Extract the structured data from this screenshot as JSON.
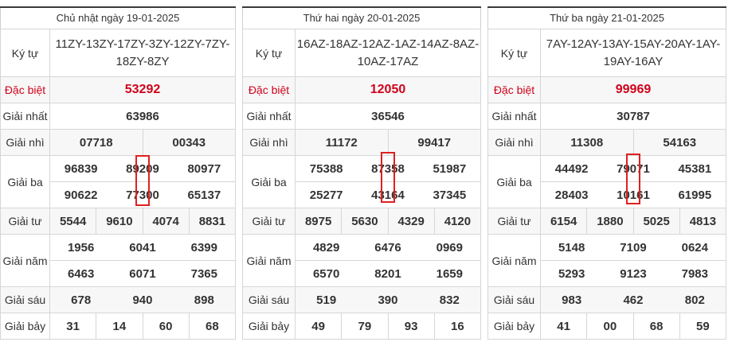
{
  "days": [
    {
      "date": "Chủ nhật ngày 19-01-2025",
      "labels": {
        "code": "Ký tự",
        "special": "Đặc biệt",
        "first": "Giải nhất",
        "second": "Giải nhì",
        "third": "Giải ba",
        "fourth": "Giải tư",
        "fifth": "Giải năm",
        "sixth": "Giải sáu",
        "seventh": "Giải bảy"
      },
      "code": "11ZY-13ZY-17ZY-3ZY-12ZY-7ZY-18ZY-8ZY",
      "special": "53292",
      "first": "63986",
      "second": [
        "07718",
        "00343"
      ],
      "third": [
        "96839",
        "89209",
        "80977",
        "90622",
        "77300",
        "65137"
      ],
      "fourth": [
        "5544",
        "9610",
        "4074",
        "8831"
      ],
      "fifth": [
        "1956",
        "6041",
        "6399",
        "6463",
        "6071",
        "7365"
      ],
      "sixth": [
        "678",
        "940",
        "898"
      ],
      "seventh": [
        "31",
        "14",
        "60",
        "68"
      ]
    },
    {
      "date": "Thứ hai ngày 20-01-2025",
      "labels": {
        "code": "Ký tự",
        "special": "Đặc biệt",
        "first": "Giải nhất",
        "second": "Giải nhì",
        "third": "Giải ba",
        "fourth": "Giải tư",
        "fifth": "Giải năm",
        "sixth": "Giải sáu",
        "seventh": "Giải bảy"
      },
      "code": "16AZ-18AZ-12AZ-1AZ-14AZ-8AZ-10AZ-17AZ",
      "special": "12050",
      "first": "36546",
      "second": [
        "11172",
        "99417"
      ],
      "third": [
        "75388",
        "87358",
        "51987",
        "25277",
        "43164",
        "37345"
      ],
      "fourth": [
        "8975",
        "5630",
        "4329",
        "4120"
      ],
      "fifth": [
        "4829",
        "6476",
        "0969",
        "6570",
        "8201",
        "1659"
      ],
      "sixth": [
        "519",
        "390",
        "832"
      ],
      "seventh": [
        "49",
        "79",
        "93",
        "16"
      ]
    },
    {
      "date": "Thứ ba ngày 21-01-2025",
      "labels": {
        "code": "Ký tự",
        "special": "Đặc biệt",
        "first": "Giải nhất",
        "second": "Giải nhì",
        "third": "Giải ba",
        "fourth": "Giải tư",
        "fifth": "Giải năm",
        "sixth": "Giải sáu",
        "seventh": "Giải bảy"
      },
      "code": "7AY-12AY-13AY-15AY-20AY-1AY-19AY-16AY",
      "special": "99969",
      "first": "30787",
      "second": [
        "11308",
        "54163"
      ],
      "third": [
        "44492",
        "79071",
        "45381",
        "28403",
        "10161",
        "61995"
      ],
      "fourth": [
        "6154",
        "1880",
        "5025",
        "4813"
      ],
      "fifth": [
        "5148",
        "7109",
        "0624",
        "5293",
        "9123",
        "7983"
      ],
      "sixth": [
        "983",
        "462",
        "802"
      ],
      "seventh": [
        "41",
        "00",
        "68",
        "59"
      ]
    }
  ],
  "colors": {
    "special": "#d0021b",
    "highlight": "#e02020",
    "border": "#d6d6d6"
  }
}
